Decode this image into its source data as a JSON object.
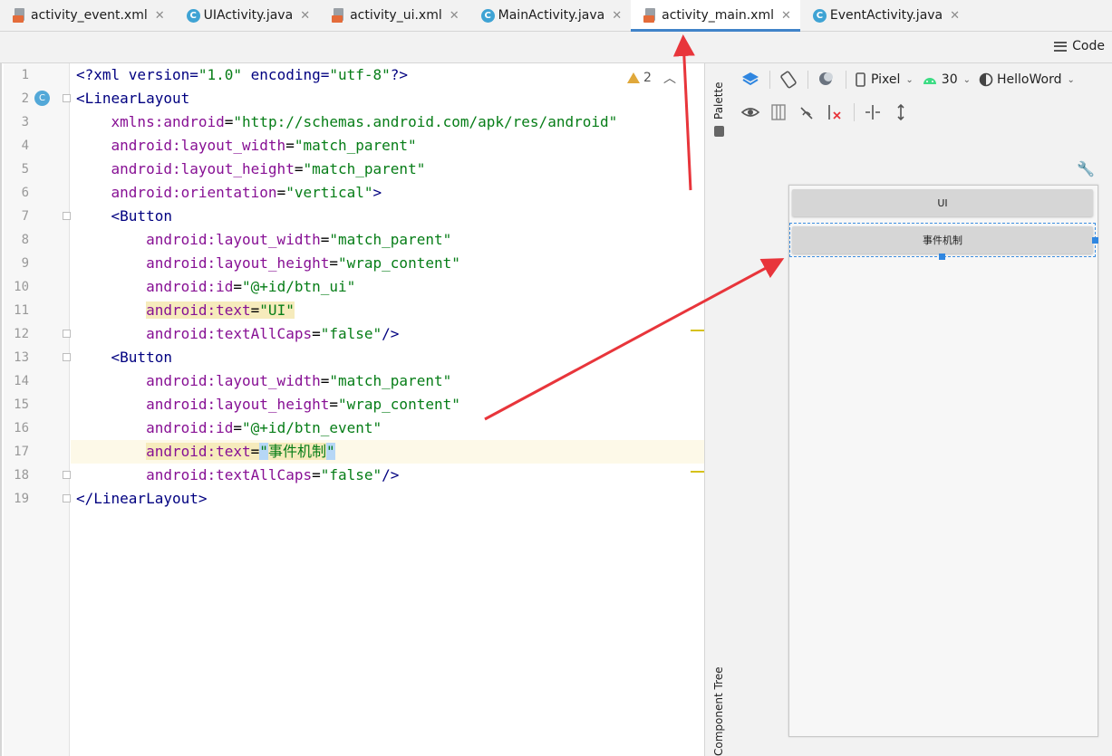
{
  "tabs": [
    {
      "label": "activity_event.xml",
      "icon": "xml-file-icon",
      "active": false
    },
    {
      "label": "UIActivity.java",
      "icon": "java-class-icon",
      "active": false
    },
    {
      "label": "activity_ui.xml",
      "icon": "xml-file-icon",
      "active": false
    },
    {
      "label": "MainActivity.java",
      "icon": "java-class-icon",
      "active": false
    },
    {
      "label": "activity_main.xml",
      "icon": "xml-file-icon",
      "active": true
    },
    {
      "label": "EventActivity.java",
      "icon": "java-class-icon",
      "active": false
    }
  ],
  "toolbar": {
    "code_label": "Code"
  },
  "editor": {
    "warning_count": "2",
    "line_numbers": [
      "1",
      "2",
      "3",
      "4",
      "5",
      "6",
      "7",
      "8",
      "9",
      "10",
      "11",
      "12",
      "13",
      "14",
      "15",
      "16",
      "17",
      "18",
      "19"
    ],
    "current_line": "17"
  },
  "side_strip": {
    "palette_label": "Palette",
    "component_tree_label": "Component Tree"
  },
  "design": {
    "device": "Pixel",
    "api_level": "30",
    "theme": "HelloWord",
    "preview_buttons": [
      "UI",
      "事件机制"
    ]
  },
  "colors": {
    "accent": "#4083c9",
    "annotation": "#e8353b",
    "selection": "#2f86e0"
  }
}
